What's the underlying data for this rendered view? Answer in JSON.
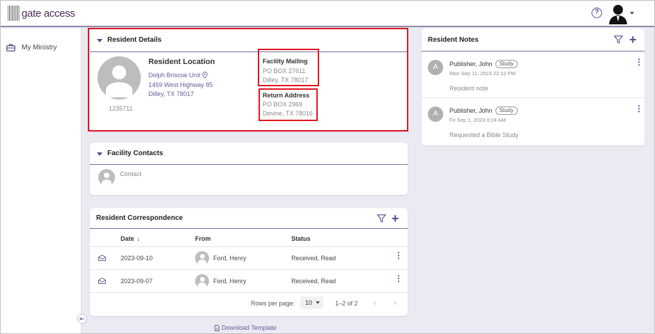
{
  "app": {
    "logo_text": "gate access"
  },
  "header": {
    "help_label": "?"
  },
  "sidebar": {
    "items": [
      {
        "label": "My Ministry"
      }
    ]
  },
  "resident_details": {
    "title": "Resident Details",
    "id": "1235711",
    "location_title": "Resident Location",
    "location_unit": "Dolph Briscoe Unit",
    "location_addr1": "1459 West Highway 85",
    "location_addr2": "Dilley, TX 78017",
    "mailing_title": "Facility Mailing",
    "mailing_addr1": "PO BOX 27611",
    "mailing_addr2": "Dilley, TX 78017",
    "return_title": "Return Address",
    "return_addr1": "PO BOX 2969",
    "return_addr2": "Devine, TX 78016"
  },
  "facility_contacts": {
    "title": "Facility Contacts",
    "contact_label": "Contact"
  },
  "correspondence": {
    "title": "Resident Correspondence",
    "columns": {
      "date": "Date",
      "sort_icon": "↓",
      "from": "From",
      "status": "Status"
    },
    "rows": [
      {
        "date": "2023-09-10",
        "from": "Ford, Henry",
        "status": "Received, Read"
      },
      {
        "date": "2023-09-07",
        "from": "Ford, Henry",
        "status": "Received, Read"
      }
    ],
    "rows_per_page_label": "Rows per page:",
    "rows_per_page_value": "10",
    "range": "1–2 of 2"
  },
  "download": {
    "label": "Download Template"
  },
  "notes": {
    "title": "Resident Notes",
    "items": [
      {
        "initial": "A",
        "author": "Publisher, John",
        "tag": "Study",
        "date": "Mon Sep 11, 2023 22:12 PM",
        "text": "Resident note"
      },
      {
        "initial": "A",
        "author": "Publisher, John",
        "tag": "Study",
        "date": "Fri Sep 1, 2023 0:24 AM",
        "text": "Requested a Bible Study"
      }
    ]
  },
  "colors": {
    "accent": "#5a4a8a",
    "highlight": "#e0141e",
    "background": "#ebe9f1"
  }
}
